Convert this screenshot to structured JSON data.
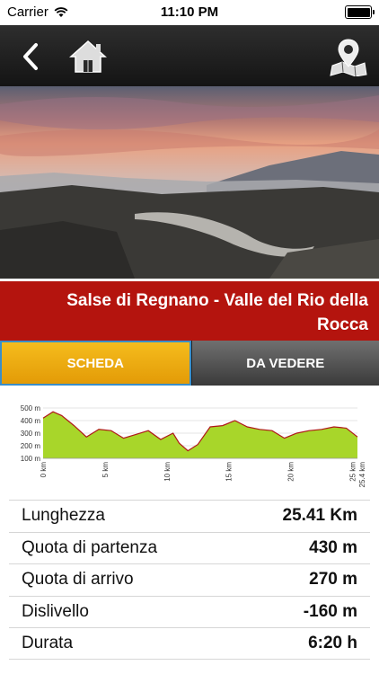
{
  "status_bar": {
    "carrier": "Carrier",
    "time": "11:10 PM",
    "battery_level": 1.0
  },
  "nav": {
    "back_icon": "chevron-left-icon",
    "home_icon": "home-icon",
    "map_icon": "map-pin-icon"
  },
  "hero": {
    "description_icon": "landscape-photo"
  },
  "title": "Salse di Regnano - Valle del Rio della Rocca",
  "tabs": [
    {
      "label": "SCHEDA",
      "active": true
    },
    {
      "label": "DA VEDERE",
      "active": false
    }
  ],
  "chart_data": {
    "type": "area",
    "y_ticks": [
      "500 m",
      "400 m",
      "300 m",
      "200 m",
      "100 m"
    ],
    "x_ticks": [
      "0 km",
      "5 km",
      "10 km",
      "15 km",
      "20 km",
      "25 km",
      "25.4 km"
    ],
    "ylim": [
      100,
      500
    ],
    "xlim": [
      0,
      25.4
    ],
    "x": [
      0,
      0.8,
      1.5,
      2.5,
      3.5,
      4.5,
      5.5,
      6.5,
      7.5,
      8.5,
      9.5,
      10.5,
      11,
      11.7,
      12.5,
      13.5,
      14.5,
      15.5,
      16.5,
      17.5,
      18.5,
      19.5,
      20.5,
      21.5,
      22.5,
      23.5,
      24.5,
      25.4
    ],
    "y": [
      420,
      470,
      440,
      360,
      270,
      330,
      320,
      260,
      290,
      320,
      250,
      300,
      220,
      160,
      210,
      350,
      360,
      400,
      350,
      330,
      320,
      260,
      300,
      320,
      330,
      350,
      340,
      270
    ],
    "fill_color": "#a8d62a",
    "line_color": "#b01818",
    "grid": true
  },
  "stats": [
    {
      "label": "Lunghezza",
      "value": "25.41 Km"
    },
    {
      "label": "Quota di partenza",
      "value": "430 m"
    },
    {
      "label": "Quota di arrivo",
      "value": "270 m"
    },
    {
      "label": "Dislivello",
      "value": "-160 m"
    },
    {
      "label": "Durata",
      "value": "6:20 h"
    }
  ]
}
